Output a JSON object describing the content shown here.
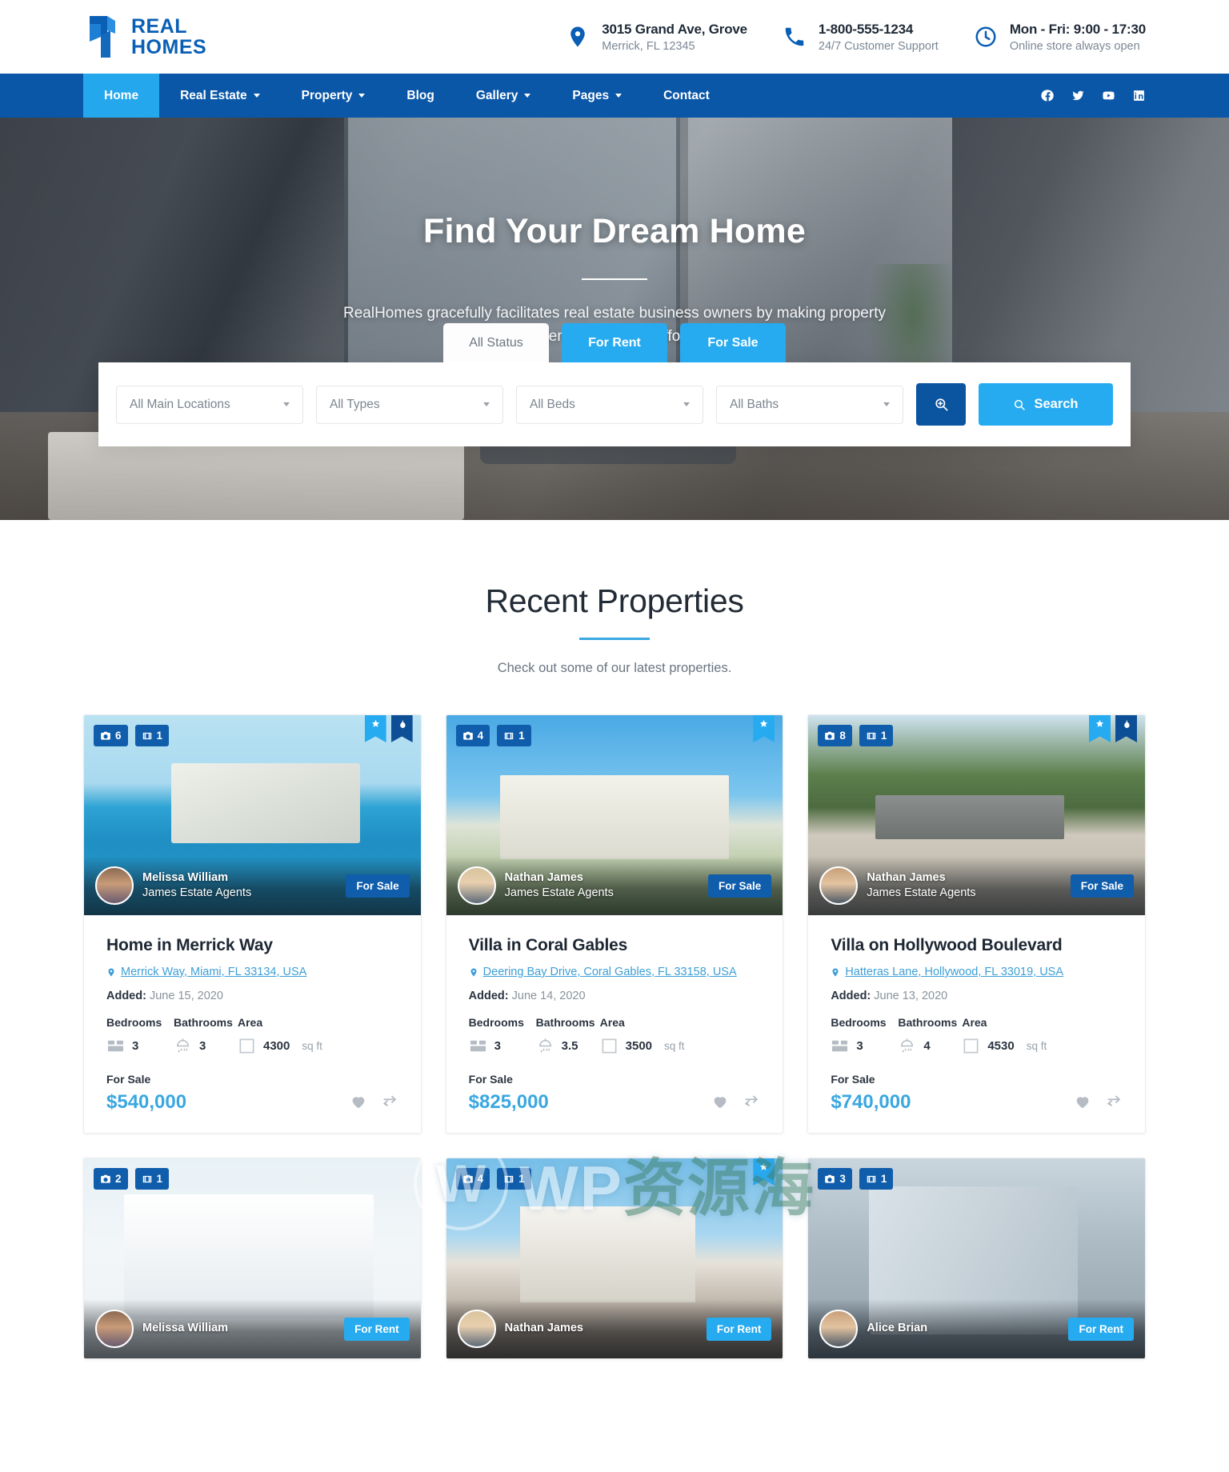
{
  "brand": {
    "line1": "REAL",
    "line2": "HOMES"
  },
  "header": {
    "contacts": [
      {
        "icon": "map-pin-icon",
        "title": "3015 Grand Ave, Grove",
        "sub": "Merrick, FL 12345"
      },
      {
        "icon": "phone-icon",
        "title": "1-800-555-1234",
        "sub": "24/7 Customer Support"
      },
      {
        "icon": "clock-icon",
        "title": "Mon - Fri: 9:00 - 17:30",
        "sub": "Online store always open"
      }
    ]
  },
  "nav": {
    "items": [
      {
        "label": "Home",
        "active": true,
        "caret": false
      },
      {
        "label": "Real Estate",
        "active": false,
        "caret": true
      },
      {
        "label": "Property",
        "active": false,
        "caret": true
      },
      {
        "label": "Blog",
        "active": false,
        "caret": false
      },
      {
        "label": "Gallery",
        "active": false,
        "caret": true
      },
      {
        "label": "Pages",
        "active": false,
        "caret": true
      },
      {
        "label": "Contact",
        "active": false,
        "caret": false
      }
    ],
    "social": [
      "facebook-icon",
      "twitter-icon",
      "youtube-icon",
      "linkedin-icon"
    ]
  },
  "hero": {
    "title": "Find Your Dream Home",
    "subtitle": "RealHomes gracefully facilitates real estate business owners by making property management easier & affordable.",
    "tabs": [
      {
        "label": "All Status",
        "style": "active"
      },
      {
        "label": "For Rent",
        "style": "fill"
      },
      {
        "label": "For Sale",
        "style": "fill"
      }
    ],
    "filters": [
      {
        "value": "All Main Locations"
      },
      {
        "value": "All Types"
      },
      {
        "value": "All Beds"
      },
      {
        "value": "All Baths"
      }
    ],
    "advanced_icon": "search-plus-icon",
    "search_label": "Search"
  },
  "recent": {
    "title": "Recent Properties",
    "subtitle": "Check out some of our latest properties.",
    "labels": {
      "added": "Added:",
      "bedrooms": "Bedrooms",
      "bathrooms": "Bathrooms",
      "area": "Area",
      "area_unit": "sq ft"
    },
    "properties": [
      {
        "photos": "6",
        "videos": "1",
        "ribbons": [
          "star",
          "hot"
        ],
        "photo_class": "ph-a",
        "agent": "Melissa William",
        "agency": "James Estate Agents",
        "avatar_class": "",
        "status": "For Sale",
        "status_class": "",
        "title": "Home in Merrick Way",
        "address": "Merrick Way, Miami, FL 33134, USA",
        "added": "June 15, 2020",
        "beds": "3",
        "baths": "3",
        "area": "4300",
        "price": "$540,000"
      },
      {
        "photos": "4",
        "videos": "1",
        "ribbons": [
          "star"
        ],
        "photo_class": "ph-b",
        "agent": "Nathan James",
        "agency": "James Estate Agents",
        "avatar_class": "m2",
        "status": "For Sale",
        "status_class": "",
        "title": "Villa in Coral Gables",
        "address": "Deering Bay Drive, Coral Gables, FL 33158, USA",
        "added": "June 14, 2020",
        "beds": "3",
        "baths": "3.5",
        "area": "3500",
        "price": "$825,000"
      },
      {
        "photos": "8",
        "videos": "1",
        "ribbons": [
          "star",
          "hot"
        ],
        "photo_class": "ph-c",
        "agent": "Nathan James",
        "agency": "James Estate Agents",
        "avatar_class": "m3",
        "status": "For Sale",
        "status_class": "",
        "title": "Villa on Hollywood Boulevard",
        "address": "Hatteras Lane, Hollywood, FL 33019, USA",
        "added": "June 13, 2020",
        "beds": "3",
        "baths": "4",
        "area": "4530",
        "price": "$740,000"
      },
      {
        "photos": "2",
        "videos": "1",
        "ribbons": [],
        "photo_class": "ph-d",
        "agent": "Melissa William",
        "agency": "",
        "avatar_class": "",
        "status": "For Rent",
        "status_class": "rent",
        "title": "",
        "address": "",
        "added": "",
        "beds": "",
        "baths": "",
        "area": "",
        "price": ""
      },
      {
        "photos": "4",
        "videos": "1",
        "ribbons": [
          "star"
        ],
        "photo_class": "ph-e",
        "agent": "Nathan James",
        "agency": "",
        "avatar_class": "m2",
        "status": "For Rent",
        "status_class": "rent",
        "title": "",
        "address": "",
        "added": "",
        "beds": "",
        "baths": "",
        "area": "",
        "price": ""
      },
      {
        "photos": "3",
        "videos": "1",
        "ribbons": [],
        "photo_class": "ph-f",
        "agent": "Alice Brian",
        "agency": "",
        "avatar_class": "m3",
        "status": "For Rent",
        "status_class": "rent",
        "title": "",
        "address": "",
        "added": "",
        "beds": "",
        "baths": "",
        "area": "",
        "price": ""
      }
    ]
  },
  "watermark": {
    "mark": "W",
    "text": "WP",
    "cn": "资源海"
  },
  "colors": {
    "primary": "#0a57a8",
    "accent": "#27abf0",
    "link": "#3aa7e0",
    "badge": "#0f5dab"
  }
}
